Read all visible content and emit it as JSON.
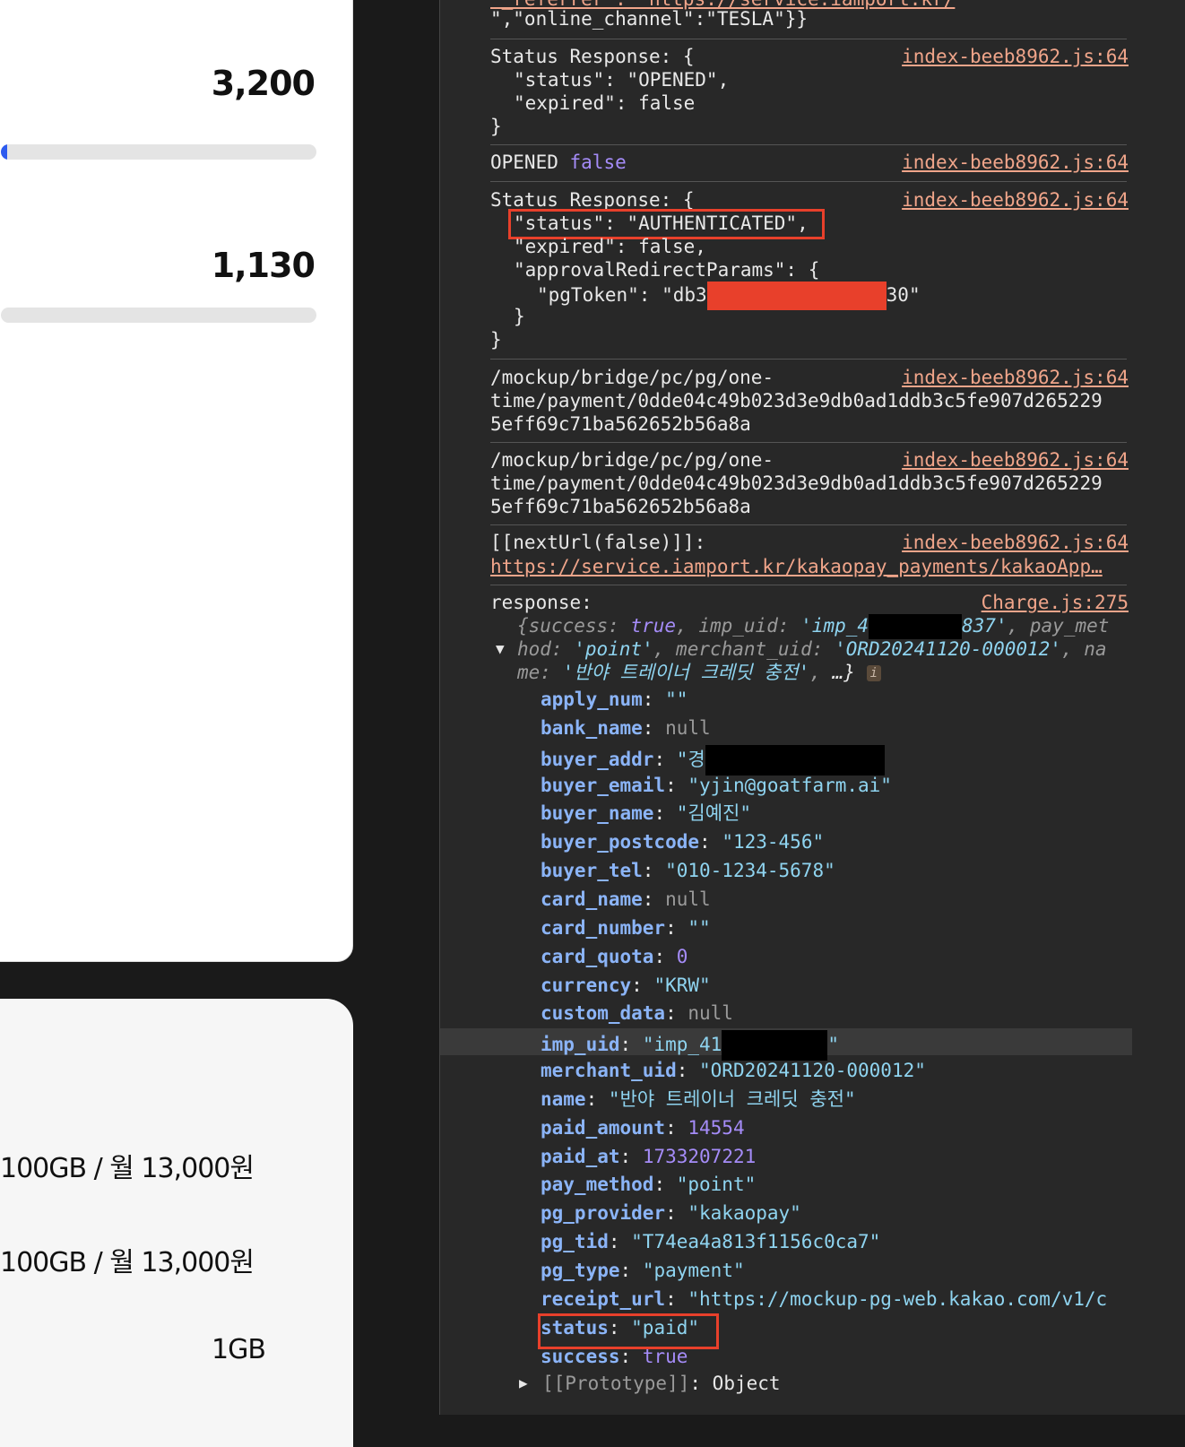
{
  "left_panel": {
    "stat1": "3,200",
    "stat1_progress_pct": 2,
    "stat2": "1,130",
    "stat2_progress_pct": 0,
    "plans": [
      "100GB / 월 13,000원",
      "100GB / 월 13,000원",
      "1GB"
    ]
  },
  "console": {
    "top_line_url": "\"_referrer\": \"https://service.iamport.kr/",
    "top_line": "\",\"online_channel\":\"TESLA\"}}",
    "src1": "index-beeb8962.js:64",
    "status_response_label": "Status Response: {",
    "status_opened": "\"status\": \"OPENED\",",
    "expired_false": "\"expired\": false",
    "close_brace": "}",
    "opened_word": "OPENED",
    "false_word": "false",
    "status_auth": "\"status\": \"AUTHENTICATED\",",
    "expired_false_comma": "\"expired\": false,",
    "approval_params": "\"approvalRedirectParams\": {",
    "pgtoken_prefix": "\"pgToken\": \"db3",
    "pgtoken_suffix": "30\"",
    "inner_close": "}",
    "mockup_path_line1": "/mockup/bridge/pc/pg/one-",
    "mockup_path_line2": "time/payment/0dde04c49b023d3e9db0ad1ddb3c5fe907d265229",
    "mockup_path_line3": "5eff69c71ba562652b56a8a",
    "nexturl_label": "[[nextUrl(false)]]:",
    "nexturl_link": "https://service.iamport.kr/kakaopay_payments/kakaoApp…",
    "response_label": "response:",
    "response_src": "Charge.js:275",
    "summary_success_label": "success",
    "summary_true": "true",
    "summary_impuid_label": "imp_uid",
    "summary_impuid_prefix": "'imp_4",
    "summary_impuid_suffix": "837'",
    "summary_pay_met": "pay_met",
    "summary_hod": "hod",
    "summary_point": "'point'",
    "summary_merchant_label": "merchant_uid",
    "summary_merchant_val": "'ORD20241120-000012'",
    "summary_na": "na",
    "summary_me": "me",
    "summary_name_val": "'반야 트레이너 크레딧 충전'",
    "summary_ellipsis": "…}",
    "info_badge": "i",
    "props": [
      {
        "key": "apply_num",
        "value": "\"\"",
        "type": "str"
      },
      {
        "key": "bank_name",
        "value": "null",
        "type": "null"
      },
      {
        "key": "buyer_addr",
        "value": "\"경",
        "type": "str",
        "redacted": true
      },
      {
        "key": "buyer_email",
        "value": "\"yjin@goatfarm.ai\"",
        "type": "str"
      },
      {
        "key": "buyer_name",
        "value": "\"김예진\"",
        "type": "str"
      },
      {
        "key": "buyer_postcode",
        "value": "\"123-456\"",
        "type": "str"
      },
      {
        "key": "buyer_tel",
        "value": "\"010-1234-5678\"",
        "type": "str"
      },
      {
        "key": "card_name",
        "value": "null",
        "type": "null"
      },
      {
        "key": "card_number",
        "value": "\"\"",
        "type": "str"
      },
      {
        "key": "card_quota",
        "value": "0",
        "type": "num"
      },
      {
        "key": "currency",
        "value": "\"KRW\"",
        "type": "str"
      },
      {
        "key": "custom_data",
        "value": "null",
        "type": "null"
      },
      {
        "key": "imp_uid",
        "value": "\"imp_41",
        "type": "str",
        "redacted": true,
        "suffix": "\""
      },
      {
        "key": "merchant_uid",
        "value": "\"ORD20241120-000012\"",
        "type": "str"
      },
      {
        "key": "name",
        "value": "\"반야 트레이너 크레딧 충전\"",
        "type": "str"
      },
      {
        "key": "paid_amount",
        "value": "14554",
        "type": "num"
      },
      {
        "key": "paid_at",
        "value": "1733207221",
        "type": "num"
      },
      {
        "key": "pay_method",
        "value": "\"point\"",
        "type": "str"
      },
      {
        "key": "pg_provider",
        "value": "\"kakaopay\"",
        "type": "str"
      },
      {
        "key": "pg_tid",
        "value": "\"T74ea4a813f1156c0ca7\"",
        "type": "str"
      },
      {
        "key": "pg_type",
        "value": "\"payment\"",
        "type": "str"
      },
      {
        "key": "receipt_url",
        "value": "\"https://mockup-pg-web.kakao.com/v1/c",
        "type": "str"
      },
      {
        "key": "status",
        "value": "\"paid\"",
        "type": "str"
      },
      {
        "key": "success",
        "value": "true",
        "type": "num"
      }
    ],
    "prototype_label": "[[Prototype]]",
    "prototype_value": "Object"
  }
}
